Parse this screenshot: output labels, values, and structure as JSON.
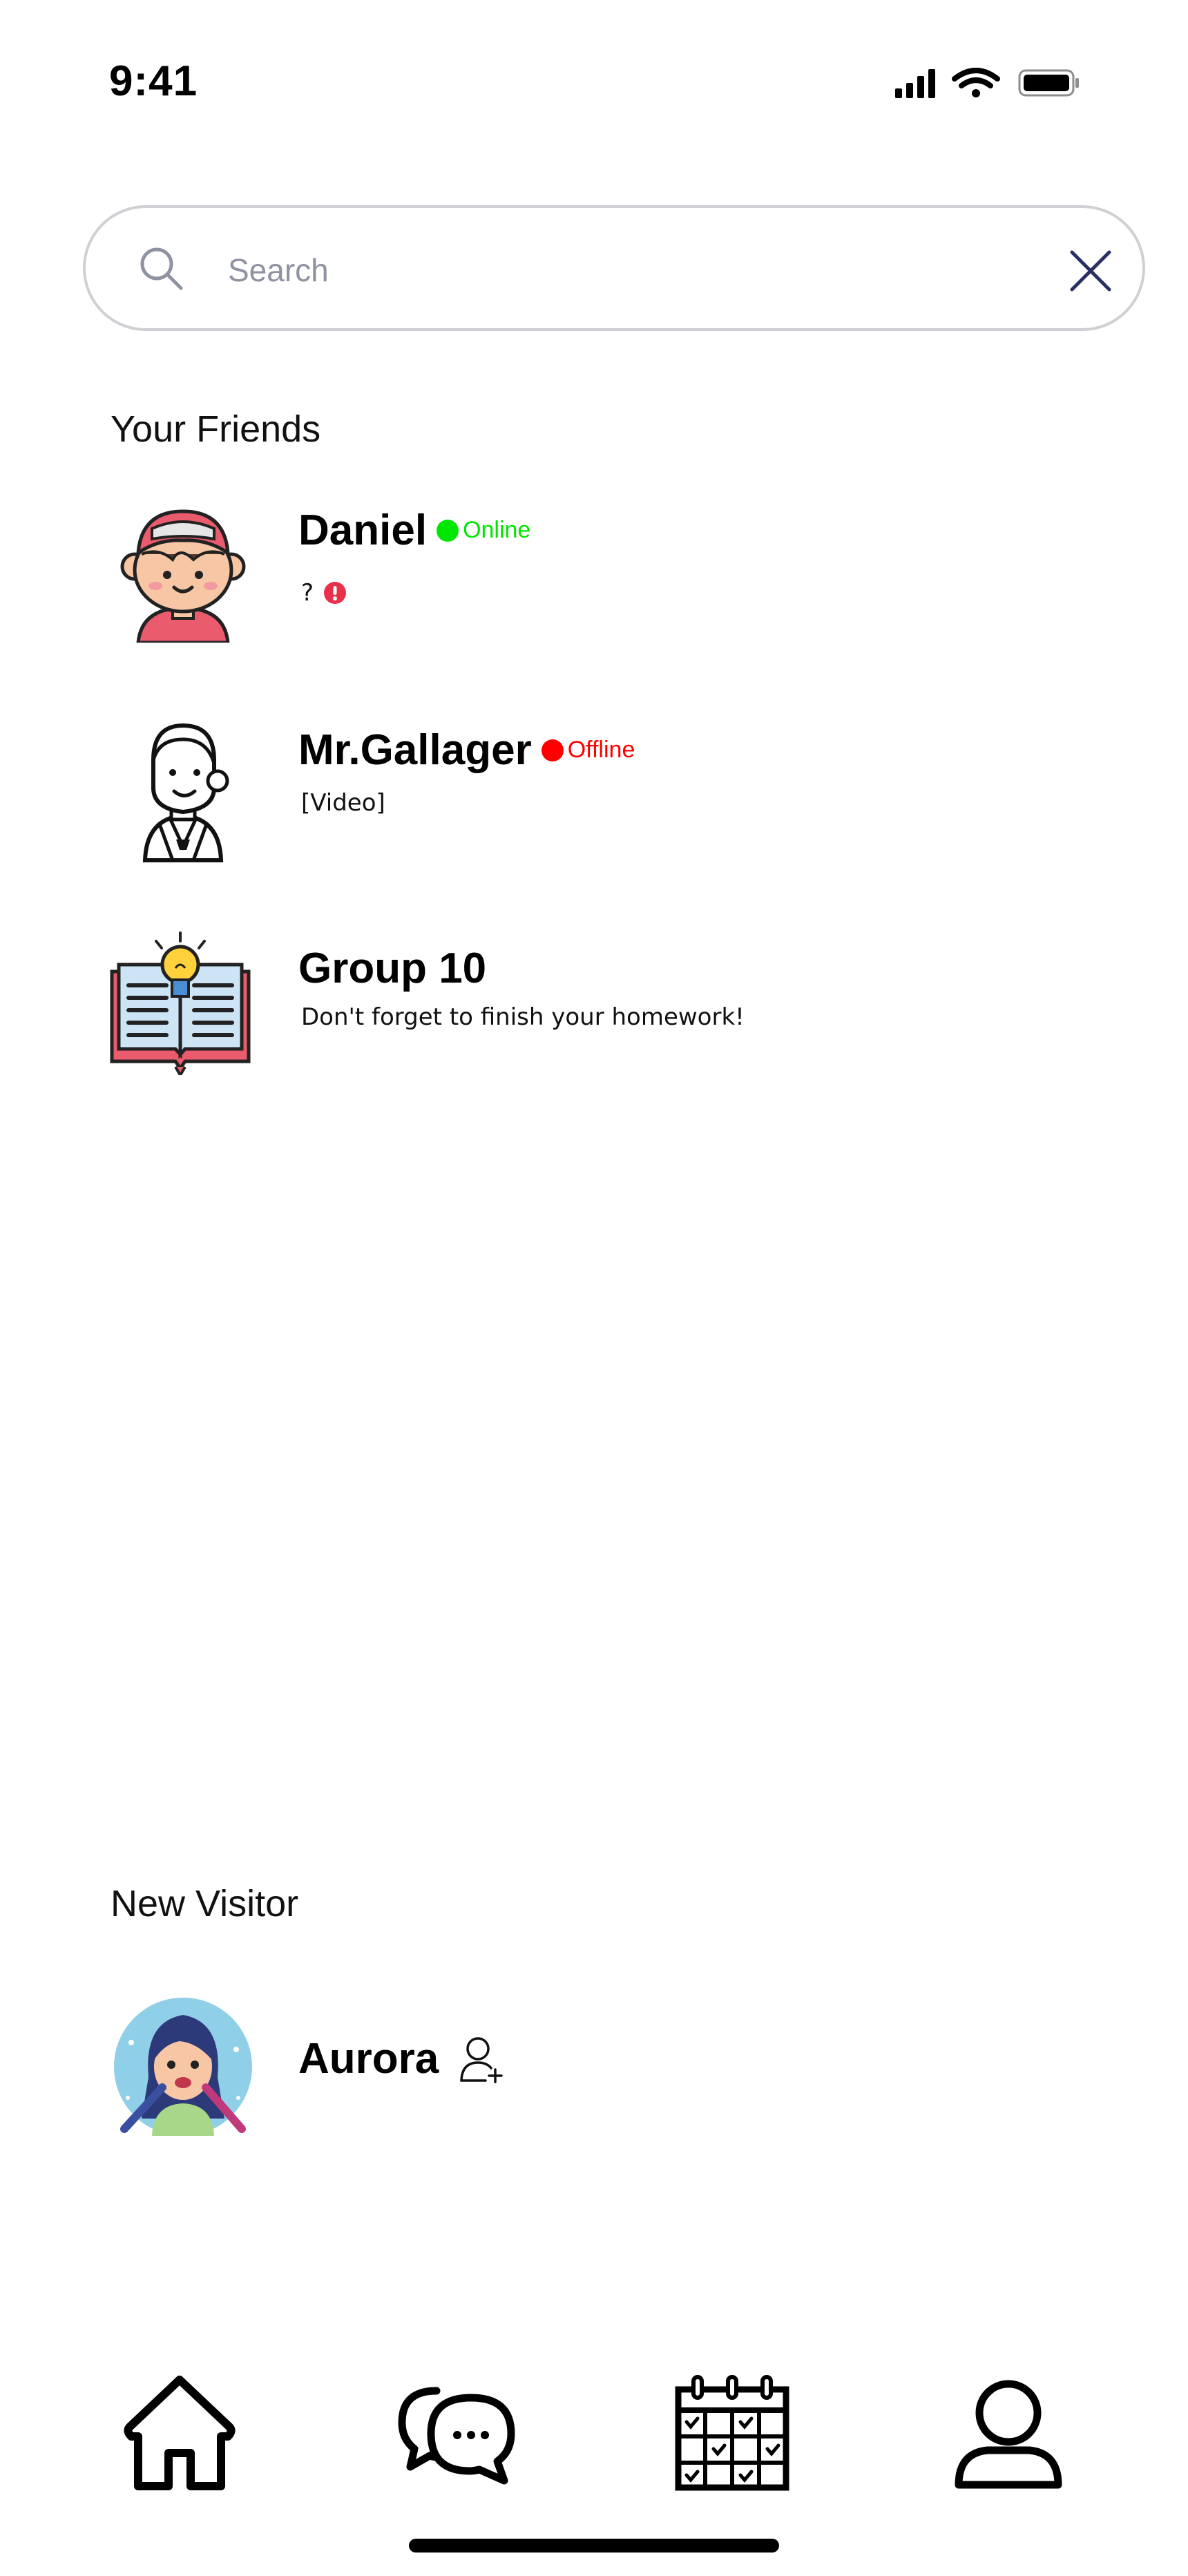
{
  "status_bar": {
    "time": "9:41"
  },
  "search": {
    "placeholder": "Search"
  },
  "friends": {
    "title": "Your Friends",
    "items": [
      {
        "name": "Daniel",
        "status": "Online",
        "status_color": "#00e600",
        "preview": "?"
      },
      {
        "name": "Mr.Gallager",
        "status": "Offline",
        "status_color": "#ff0000",
        "preview": "[Video]"
      },
      {
        "name": "Group 10",
        "preview": "Don't forget to finish your homework!"
      }
    ]
  },
  "visitor": {
    "title": "New Visitor",
    "name": "Aurora"
  },
  "nav": {
    "icons": [
      "home-icon",
      "chat-icon",
      "calendar-icon",
      "profile-icon"
    ]
  },
  "colors": {
    "accent_red": "#e8304a",
    "muted": "#8e92a1"
  }
}
